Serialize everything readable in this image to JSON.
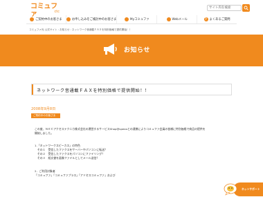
{
  "header": {
    "logo_main": "コミュファ",
    "logo_sub": "ctc",
    "search_placeholder": "サイト内を検索"
  },
  "gnav": {
    "items": [
      {
        "label": "ご契約中のお客さま"
      },
      {
        "label": "お申し込みをご検討中のお客さま"
      },
      {
        "label": "Myコミュファ"
      },
      {
        "label": "Webメール"
      },
      {
        "label": "よくあるご質問"
      }
    ]
  },
  "breadcrumb": {
    "items": [
      "コミュファ光 公式サイト",
      "お知らせ",
      "ネットワーク音通載ＦＡＸを特別価格で提供開始！！"
    ],
    "separator": "›"
  },
  "banner": {
    "title": "お知らせ",
    "color": "#f08a1e"
  },
  "article": {
    "title": "ネットワーク音通載ＦＡＸを特別価格で提供開始！！",
    "date": "2008年9月8日",
    "tag": "ご契約中のお客さま",
    "lines": [
      "この度、ＮＥＣアクセステクニカ株式会社の運営するサービスShop@speaxとの連携によりコミュファ会員の皆様に特別価格で商品の提供を",
      "開始しました。",
      "",
      "1.「ネットワークスピーカス」の特色",
      "　その１　受信したファクスをサーバーやパソコンに転送？",
      "　その２　受信したファクスをパソコンにファイリング？",
      "　その３　紙文書を画像ファイルとしてメール送信？",
      "",
      "",
      "2．ご利用対象者",
      "「コミュファ」「コミュファプラス」「アドセスコミュファ」および"
    ]
  },
  "support": {
    "label": "ネットサポート"
  }
}
